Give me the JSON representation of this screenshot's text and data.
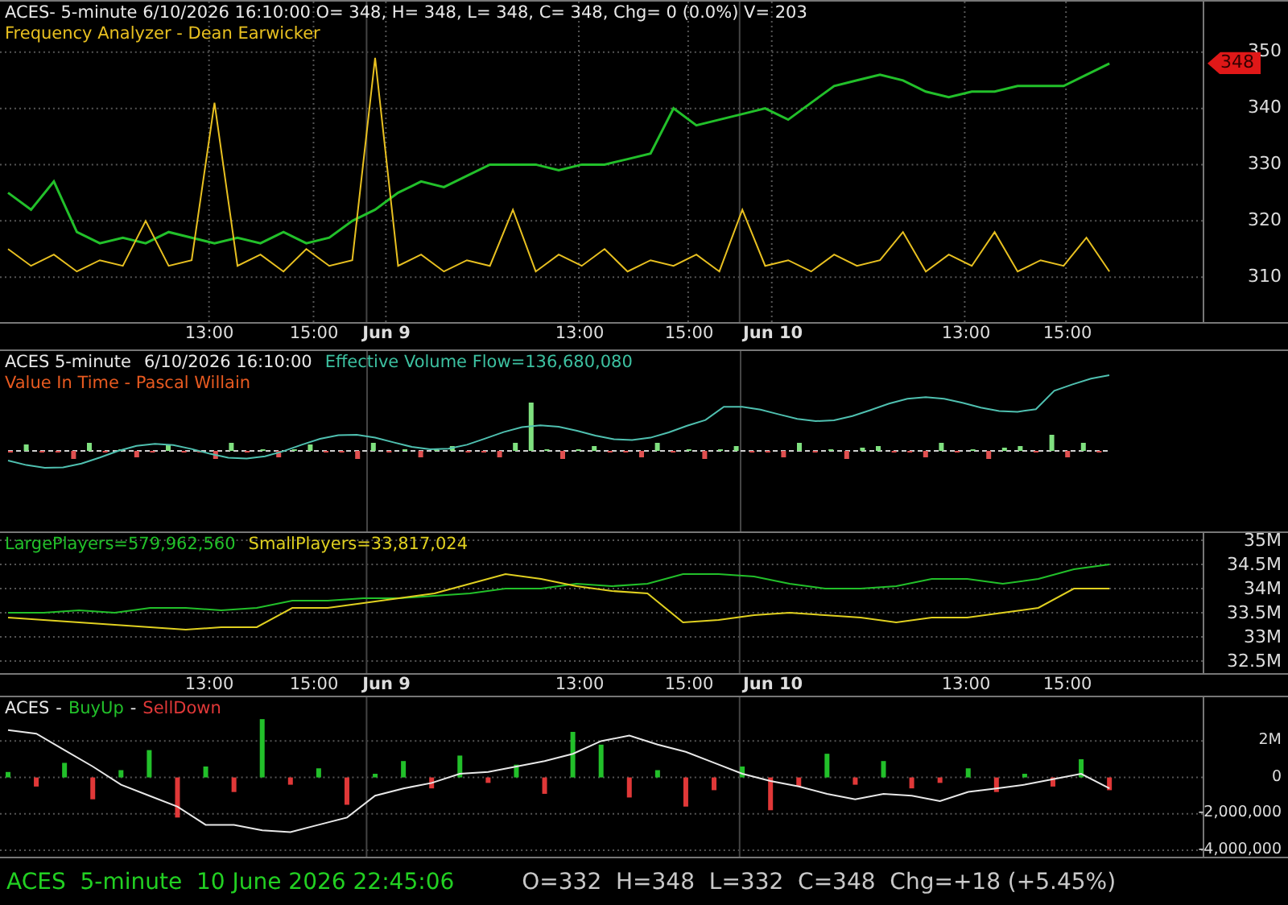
{
  "price_panel": {
    "title": "ACES- 5-minute 6/10/2026 16:10:00 O= 348, H= 348, L= 348, C= 348, Chg= 0 (0.0%) V= 203",
    "indicator": "Frequency Analyzer - Dean Earwicker",
    "last_price_tag": "348",
    "chart_data": {
      "type": "line",
      "grid": true,
      "ylim": [
        302,
        359
      ],
      "yticks": [
        {
          "value": 310,
          "label": "310"
        },
        {
          "value": 320,
          "label": "320"
        },
        {
          "value": 330,
          "label": "330"
        },
        {
          "value": 340,
          "label": "340"
        },
        {
          "value": 350,
          "label": "350"
        }
      ],
      "series": [
        {
          "color": "#22c02a",
          "values": [
            325,
            322,
            327,
            318,
            316,
            317,
            316,
            318,
            317,
            316,
            317,
            316,
            318,
            316,
            317,
            320,
            322,
            325,
            327,
            326,
            328,
            330,
            330,
            330,
            329,
            330,
            330,
            331,
            332,
            340,
            337,
            338,
            339,
            340,
            338,
            341,
            344,
            345,
            346,
            345,
            343,
            342,
            343,
            343,
            344,
            344,
            344,
            346,
            348
          ]
        },
        {
          "color": "#e8c020",
          "values": [
            315,
            312,
            314,
            311,
            313,
            312,
            320,
            312,
            313,
            341,
            312,
            314,
            311,
            315,
            312,
            313,
            349,
            312,
            314,
            311,
            313,
            312,
            322,
            311,
            314,
            312,
            315,
            311,
            313,
            312,
            314,
            311,
            322,
            312,
            313,
            311,
            314,
            312,
            313,
            318,
            311,
            314,
            312,
            318,
            311,
            313,
            312,
            317,
            311
          ]
        }
      ]
    }
  },
  "time_axis_top": [
    {
      "label": "13:00",
      "kind": "time"
    },
    {
      "label": "15:00",
      "kind": "time"
    },
    {
      "label": "Jun 9",
      "kind": "day"
    },
    {
      "label": "13:00",
      "kind": "time"
    },
    {
      "label": "15:00",
      "kind": "time"
    },
    {
      "label": "Jun 10",
      "kind": "day"
    },
    {
      "label": "13:00",
      "kind": "time"
    },
    {
      "label": "15:00",
      "kind": "time"
    }
  ],
  "volume_panel": {
    "symbol": "ACES 5-minute",
    "timestamp": "6/10/2026 16:10:00",
    "flow": "Effective Volume Flow=136,680,080",
    "indicator": "Value In Time - Pascal Willain"
  },
  "players_panel": {
    "large_value": "=579,962,560",
    "small_value": "=33,817,024",
    "chart_data": {
      "type": "line",
      "grid": true,
      "ylim": [
        32250000,
        35150000
      ],
      "yticks": [
        {
          "value": 32500000,
          "label": "32.5M"
        },
        {
          "value": 33000000,
          "label": "33M"
        },
        {
          "value": 33500000,
          "label": "33.5M"
        },
        {
          "value": 34000000,
          "label": "34M"
        },
        {
          "value": 34500000,
          "label": "34.5M"
        },
        {
          "value": 35000000,
          "label": "35M"
        }
      ],
      "series": [
        {
          "name": "LargePlayers",
          "color": "#22c02a",
          "values": [
            33500000,
            33500000,
            33550000,
            33500000,
            33600000,
            33600000,
            33550000,
            33600000,
            33750000,
            33750000,
            33800000,
            33800000,
            33850000,
            33900000,
            34000000,
            34000000,
            34100000,
            34050000,
            34100000,
            34300000,
            34300000,
            34250000,
            34100000,
            34000000,
            34000000,
            34050000,
            34200000,
            34200000,
            34100000,
            34200000,
            34400000,
            34500000
          ]
        },
        {
          "name": "SmallPlayers",
          "color": "#e0d020",
          "values": [
            33400000,
            33350000,
            33300000,
            33250000,
            33200000,
            33150000,
            33200000,
            33200000,
            33600000,
            33600000,
            33700000,
            33800000,
            33900000,
            34100000,
            34300000,
            34200000,
            34050000,
            33950000,
            33900000,
            33300000,
            33350000,
            33450000,
            33500000,
            33450000,
            33400000,
            33300000,
            33400000,
            33400000,
            33500000,
            33600000,
            34000000,
            34000000
          ]
        }
      ]
    }
  },
  "time_axis_bottom": [
    {
      "label": "13:00",
      "kind": "time"
    },
    {
      "label": "15:00",
      "kind": "time"
    },
    {
      "label": "Jun 9",
      "kind": "day"
    },
    {
      "label": "13:00",
      "kind": "time"
    },
    {
      "label": "15:00",
      "kind": "time"
    },
    {
      "label": "Jun 10",
      "kind": "day"
    },
    {
      "label": "13:00",
      "kind": "time"
    },
    {
      "label": "15:00",
      "kind": "time"
    }
  ],
  "flow_panel": {
    "symbol": "ACES",
    "sep1": "-",
    "sep2": "-",
    "chart_data": {
      "type": "bar",
      "grid": true,
      "ylim": [
        -4350000,
        4400000
      ],
      "yticks": [
        {
          "value": 2000000,
          "label": "2M"
        },
        {
          "value": 0,
          "label": "0"
        },
        {
          "value": -2000000,
          "label": "-2,000,000"
        },
        {
          "value": -4000000,
          "label": "-4,000,000"
        }
      ],
      "series": [
        {
          "name": "BuyUp",
          "color": "#22c02a",
          "values": [
            300000,
            null,
            800000,
            null,
            400000,
            1500000,
            null,
            600000,
            null,
            3200000,
            null,
            500000,
            null,
            200000,
            900000,
            null,
            1200000,
            null,
            700000,
            null,
            2500000,
            1800000,
            null,
            400000,
            null,
            null,
            600000,
            null,
            null,
            1300000,
            null,
            900000,
            null,
            null,
            500000,
            null,
            200000,
            null,
            1000000,
            null
          ]
        },
        {
          "name": "SellDown",
          "color": "#e03838",
          "values": [
            null,
            -500000,
            null,
            -1200000,
            null,
            null,
            -2200000,
            null,
            -800000,
            null,
            -400000,
            null,
            -1500000,
            null,
            null,
            -600000,
            null,
            -300000,
            null,
            -900000,
            null,
            null,
            -1100000,
            null,
            -1600000,
            -700000,
            null,
            -1800000,
            -500000,
            null,
            -400000,
            null,
            -600000,
            -300000,
            null,
            -800000,
            null,
            -500000,
            null,
            -700000
          ]
        },
        {
          "color": "#e8e8e8",
          "type": "line",
          "values": [
            2600000,
            2400000,
            1500000,
            600000,
            -400000,
            -1000000,
            -1600000,
            -2600000,
            -2600000,
            -2900000,
            -3000000,
            -2600000,
            -2200000,
            -1000000,
            -600000,
            -300000,
            200000,
            300000,
            600000,
            900000,
            1300000,
            2000000,
            2300000,
            1800000,
            1400000,
            800000,
            200000,
            -200000,
            -500000,
            -900000,
            -1200000,
            -900000,
            -1000000,
            -1300000,
            -800000,
            -600000,
            -400000,
            -100000,
            200000,
            -600000
          ]
        }
      ]
    }
  },
  "status_bar": {
    "symbol": "ACES  5-minute  10 June 2026 22:45:06",
    "quote": "O=332  H=348  L=332  C=348  Chg=+18 (+5.45%)"
  }
}
